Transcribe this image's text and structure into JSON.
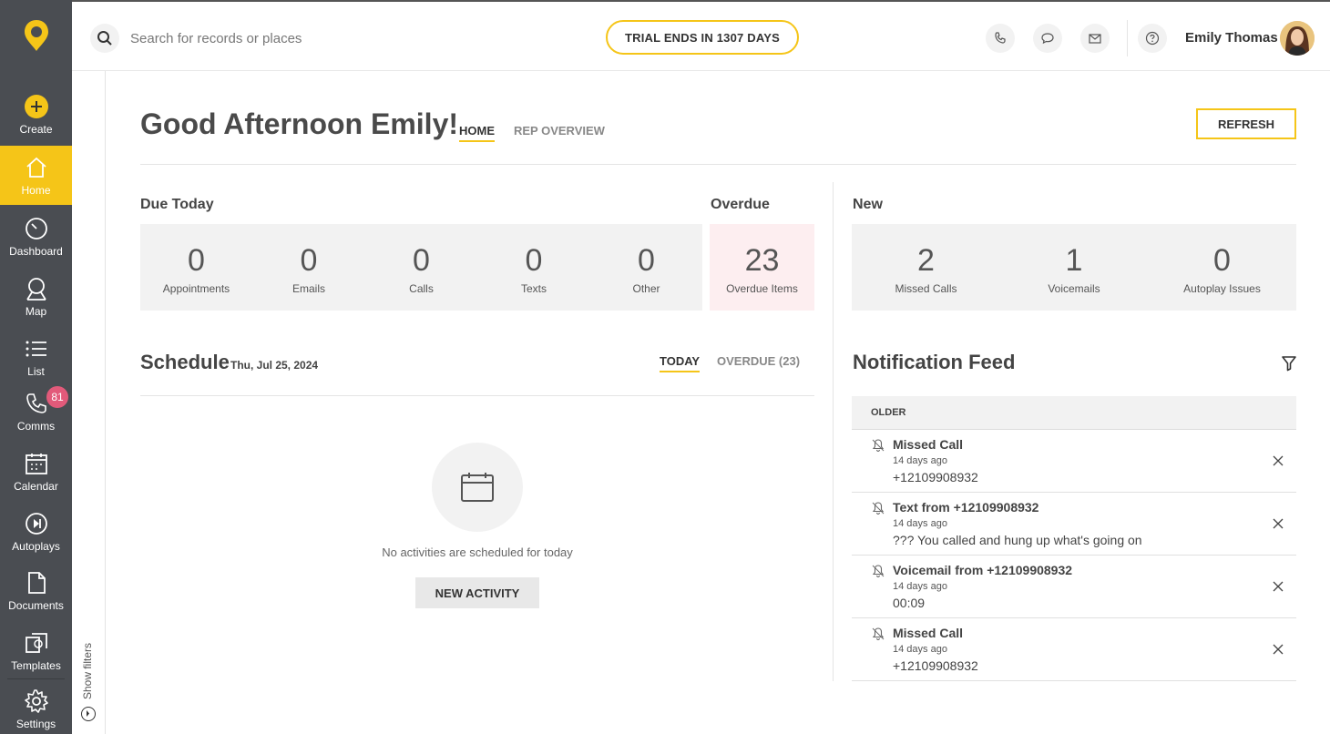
{
  "sidebar": {
    "items": [
      {
        "label": "Create",
        "icon": "plus-circle-icon"
      },
      {
        "label": "Home",
        "icon": "home-icon",
        "active": true
      },
      {
        "label": "Dashboard",
        "icon": "gauge-icon"
      },
      {
        "label": "Map",
        "icon": "map-pin-icon"
      },
      {
        "label": "List",
        "icon": "list-icon"
      },
      {
        "label": "Comms",
        "icon": "phone-icon",
        "badge": "81"
      },
      {
        "label": "Calendar",
        "icon": "calendar-icon"
      },
      {
        "label": "Autoplays",
        "icon": "play-circle-icon"
      },
      {
        "label": "Documents",
        "icon": "document-icon"
      },
      {
        "label": "Templates",
        "icon": "templates-icon"
      },
      {
        "label": "Settings",
        "icon": "gear-icon"
      }
    ],
    "show_filters": "Show filters"
  },
  "topbar": {
    "search_placeholder": "Search for records or places",
    "trial": "TRIAL ENDS IN 1307 DAYS",
    "user_name": "Emily Thomas"
  },
  "header": {
    "greeting": "Good Afternoon Emily!",
    "tabs": [
      "HOME",
      "REP OVERVIEW"
    ],
    "refresh": "REFRESH"
  },
  "due_today": {
    "title": "Due Today",
    "stats": [
      {
        "value": "0",
        "label": "Appointments"
      },
      {
        "value": "0",
        "label": "Emails"
      },
      {
        "value": "0",
        "label": "Calls"
      },
      {
        "value": "0",
        "label": "Texts"
      },
      {
        "value": "0",
        "label": "Other"
      }
    ]
  },
  "overdue": {
    "title": "Overdue",
    "value": "23",
    "label": "Overdue Items"
  },
  "new": {
    "title": "New",
    "stats": [
      {
        "value": "2",
        "label": "Missed Calls"
      },
      {
        "value": "1",
        "label": "Voicemails"
      },
      {
        "value": "0",
        "label": "Autoplay Issues"
      }
    ]
  },
  "schedule": {
    "title": "Schedule",
    "date": "Thu, Jul 25, 2024",
    "tabs": [
      "TODAY",
      "OVERDUE (23)"
    ],
    "empty_text": "No activities are scheduled for today",
    "new_activity": "NEW ACTIVITY"
  },
  "notifications": {
    "title": "Notification Feed",
    "group": "OLDER",
    "items": [
      {
        "title": "Missed Call",
        "time": "14 days ago",
        "body": "+12109908932"
      },
      {
        "title": "Text from +12109908932",
        "time": "14 days ago",
        "body": "??? You called and hung up what's going on"
      },
      {
        "title": "Voicemail from +12109908932",
        "time": "14 days ago",
        "body": "00:09"
      },
      {
        "title": "Missed Call",
        "time": "14 days ago",
        "body": "+12109908932"
      }
    ]
  },
  "colors": {
    "accent": "#f5c518",
    "sidebar": "#4a4d52",
    "overdue_bg": "#fdeef0",
    "badge": "#e25a7a"
  }
}
